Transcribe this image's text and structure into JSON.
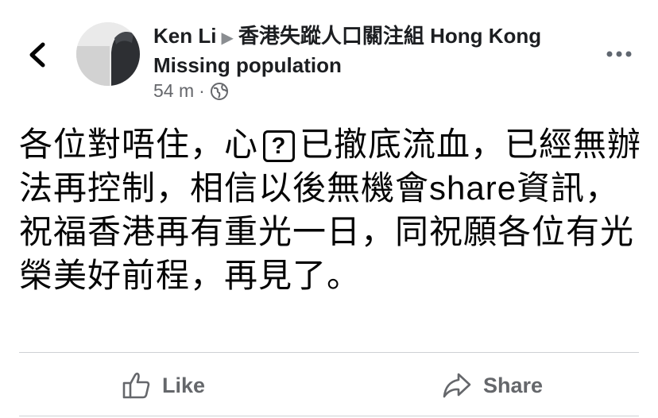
{
  "post": {
    "author": "Ken Li",
    "group": "香港失蹤人口關注組 Hong Kong Missing population",
    "time": "54 m",
    "dot": "·",
    "text_before": "各位對唔住，心",
    "placeholder_glyph": "?",
    "text_after": "已撤底流血，已經無辦法再控制，相信以後無機會share資訊，祝福香港再有重光一日，同祝願各位有光榮美好前程，再見了。"
  },
  "actions": {
    "like_label": "Like",
    "share_label": "Share"
  },
  "icons": {
    "back": "chevron-left-icon",
    "privacy": "globe-icon",
    "more": "more-dots-icon",
    "like": "thumbs-up-icon",
    "share": "share-arrow-icon"
  }
}
